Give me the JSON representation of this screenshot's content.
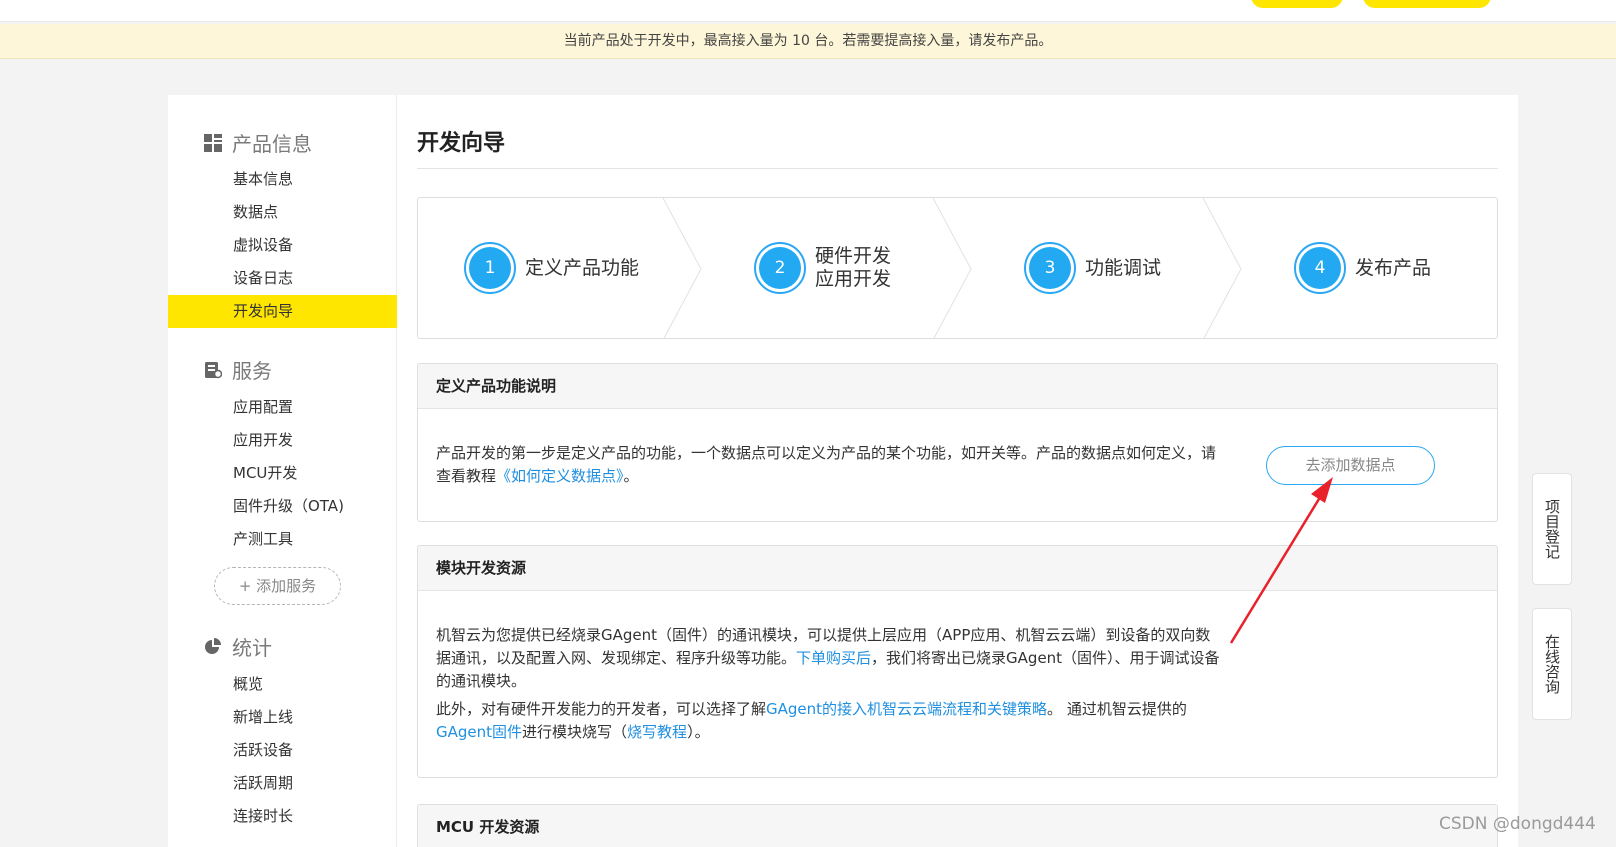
{
  "notice": "当前产品处于开发中，最高接入量为 10 台。若需要提高接入量，请发布产品。",
  "sidebar": {
    "sections": [
      {
        "title": "产品信息",
        "icon": "grid-icon",
        "items": [
          "基本信息",
          "数据点",
          "虚拟设备",
          "设备日志",
          "开发向导"
        ]
      },
      {
        "title": "服务",
        "icon": "service-icon",
        "items": [
          "应用配置",
          "应用开发",
          "MCU开发",
          "固件升级（OTA)",
          "产测工具"
        ]
      },
      {
        "title": "统计",
        "icon": "pie-chart-icon",
        "items": [
          "概览",
          "新增上线",
          "活跃设备",
          "活跃周期",
          "连接时长"
        ]
      }
    ],
    "active_item": "开发向导",
    "add_service": "+ 添加服务"
  },
  "main": {
    "title": "开发向导",
    "steps": [
      {
        "num": "1",
        "label": "定义产品功能"
      },
      {
        "num": "2",
        "label_line1": "硬件开发",
        "label_line2": "应用开发"
      },
      {
        "num": "3",
        "label": "功能调试"
      },
      {
        "num": "4",
        "label": "发布产品"
      }
    ],
    "define_box": {
      "header": "定义产品功能说明",
      "text_before": "产品开发的第一步是定义产品的功能，一个数据点可以定义为产品的某个功能，如开关等。产品的数据点如何定义，请查看教程",
      "link": "《如何定义数据点》",
      "text_after": "。",
      "button": "去添加数据点"
    },
    "module_box": {
      "header": "模块开发资源",
      "p1_before": "机智云为您提供已经烧录GAgent（固件）的通讯模块，可以提供上层应用（APP应用、机智云云端）到设备的双向数据通讯，以及配置入网、发现绑定、程序升级等功能。",
      "p1_link": "下单购买后",
      "p1_after": "，我们将寄出已烧录GAgent（固件）、用于调试设备的通讯模块。",
      "p2_before": "此外，对有硬件开发能力的开发者，可以选择了解",
      "p2_link1": "GAgent的接入机智云云端流程和关键策略",
      "p2_mid": "。 通过机智云提供的",
      "p2_link2": "GAgent固件",
      "p2_mid2": "进行模块烧写（",
      "p2_link3": "烧写教程",
      "p2_after": "）。"
    },
    "mcu_box": {
      "header": "MCU 开发资源"
    }
  },
  "float_tabs": {
    "register": "项目登记",
    "consult": "在线咨询"
  },
  "watermark": "CSDN @dongd444",
  "colors": {
    "accent_yellow": "#ffe600",
    "step_blue": "#23a9f2",
    "link_blue": "#1f8fe0",
    "annotation_red": "#e8212a"
  }
}
